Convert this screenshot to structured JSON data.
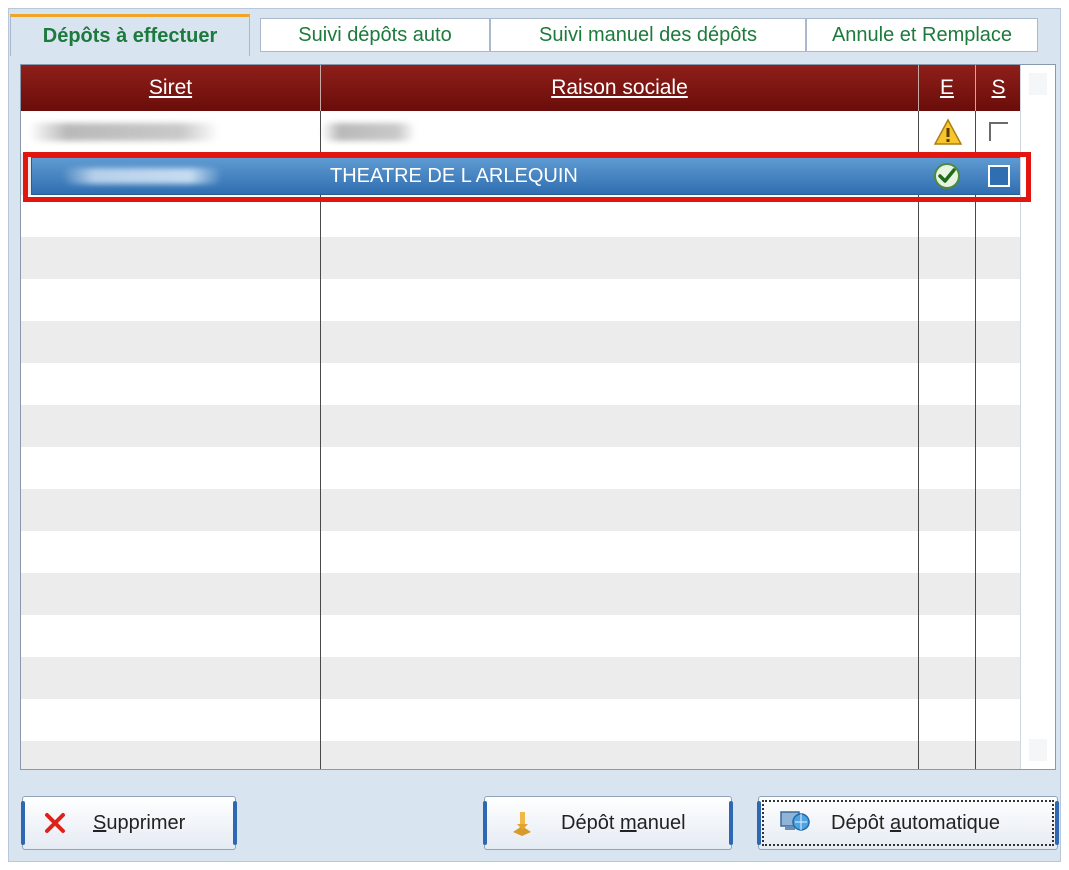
{
  "tabs": [
    {
      "label": "Dépôts à effectuer",
      "active": true
    },
    {
      "label": "Suivi dépôts auto",
      "active": false
    },
    {
      "label": "Suivi manuel des dépôts",
      "active": false
    },
    {
      "label": "Annule et Remplace",
      "active": false
    }
  ],
  "grid": {
    "columns": [
      {
        "label": "Siret"
      },
      {
        "label": "Raison sociale"
      },
      {
        "label": "E"
      },
      {
        "label": "S"
      }
    ],
    "rows": [
      {
        "siret": "",
        "raison_sociale": "",
        "e_icon": "warning-icon",
        "s_checked": false,
        "selected": false
      },
      {
        "siret": "",
        "raison_sociale": "THEATRE DE L ARLEQUIN",
        "e_icon": "check-ok-icon",
        "s_checked": false,
        "selected": true
      }
    ]
  },
  "buttons": {
    "supprimer": {
      "prefix": "",
      "key": "S",
      "rest": "upprimer",
      "icon": "delete-x-icon"
    },
    "depot_manuel": {
      "prefix": "Dépôt ",
      "key": "m",
      "rest": "anuel",
      "icon": "manual-deposit-icon"
    },
    "depot_auto": {
      "prefix": "Dépôt ",
      "key": "a",
      "rest": "utomatique",
      "icon": "network-globe-icon"
    }
  },
  "colors": {
    "header_bg": "#7d1712",
    "tab_text": "#1c7a3c",
    "active_tab_accent": "#f0a528",
    "selection": "#3a7bc0",
    "highlight_border": "#e3150f"
  }
}
